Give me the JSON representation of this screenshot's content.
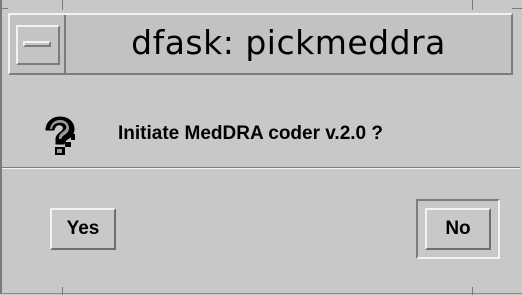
{
  "window": {
    "title": "dfask: pickmeddra"
  },
  "dialog": {
    "icon": "question-icon",
    "message": "Initiate MedDRA coder v.2.0 ?"
  },
  "buttons": {
    "yes_label": "Yes",
    "no_label": "No",
    "default_button": "No"
  },
  "colors": {
    "background": "#c8c8c8",
    "highlight": "#f2f2f2",
    "shadow": "#7c7c7c"
  }
}
